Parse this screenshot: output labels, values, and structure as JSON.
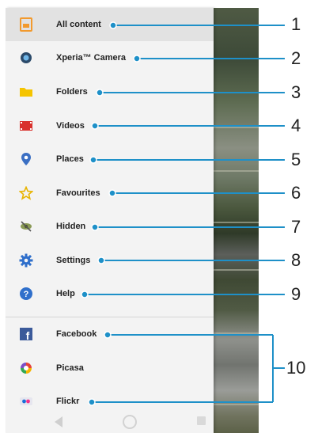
{
  "menu": {
    "items": [
      {
        "label": "All content",
        "icon": "all-content-icon",
        "selected": true
      },
      {
        "label": "Xperia™ Camera",
        "icon": "camera-icon"
      },
      {
        "label": "Folders",
        "icon": "folder-icon"
      },
      {
        "label": "Videos",
        "icon": "film-icon"
      },
      {
        "label": "Places",
        "icon": "location-pin-icon"
      },
      {
        "label": "Favourites",
        "icon": "star-icon"
      },
      {
        "label": "Hidden",
        "icon": "hidden-icon"
      },
      {
        "label": "Settings",
        "icon": "gear-icon"
      },
      {
        "label": "Help",
        "icon": "help-icon"
      }
    ],
    "services": [
      {
        "label": "Facebook",
        "icon": "facebook-icon"
      },
      {
        "label": "Picasa",
        "icon": "picasa-icon"
      },
      {
        "label": "Flickr",
        "icon": "flickr-icon"
      }
    ]
  },
  "callouts": [
    "1",
    "2",
    "3",
    "4",
    "5",
    "6",
    "7",
    "8",
    "9",
    "10"
  ],
  "colors": {
    "accent_blue": "#1e90c8",
    "folder_yellow": "#f5c400",
    "video_red": "#d9302c",
    "all_content_orange": "#f29a2e"
  }
}
